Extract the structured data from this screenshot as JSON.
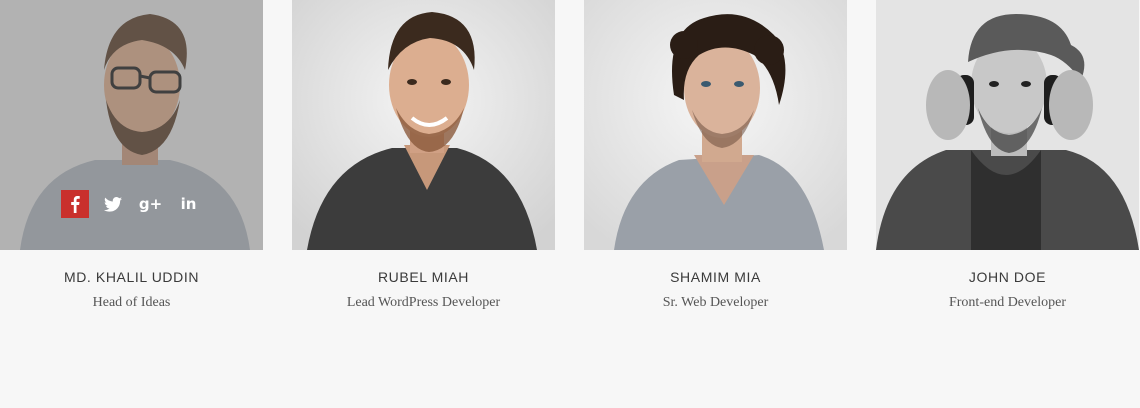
{
  "colors": {
    "background": "#f7f7f7",
    "facebook_active": "#c9302c",
    "name_text": "#3a3a3a",
    "role_text": "#555555"
  },
  "members": [
    {
      "name": "MD. KHALIL UDDIN",
      "role": "Head of Ideas",
      "photo": "man-with-glasses-beard-photo",
      "hover_active": true,
      "social": [
        "facebook-icon",
        "twitter-icon",
        "google-plus-icon",
        "linkedin-icon"
      ]
    },
    {
      "name": "RUBEL MIAH",
      "role": "Lead WordPress Developer",
      "photo": "smiling-man-dark-shirt-photo"
    },
    {
      "name": "SHAMIM MIA",
      "role": "Sr. Web Developer",
      "photo": "man-curly-hair-grey-tshirt-photo"
    },
    {
      "name": "JOHN DOE",
      "role": "Front-end Developer",
      "photo": "man-cap-headphones-photo"
    }
  ]
}
